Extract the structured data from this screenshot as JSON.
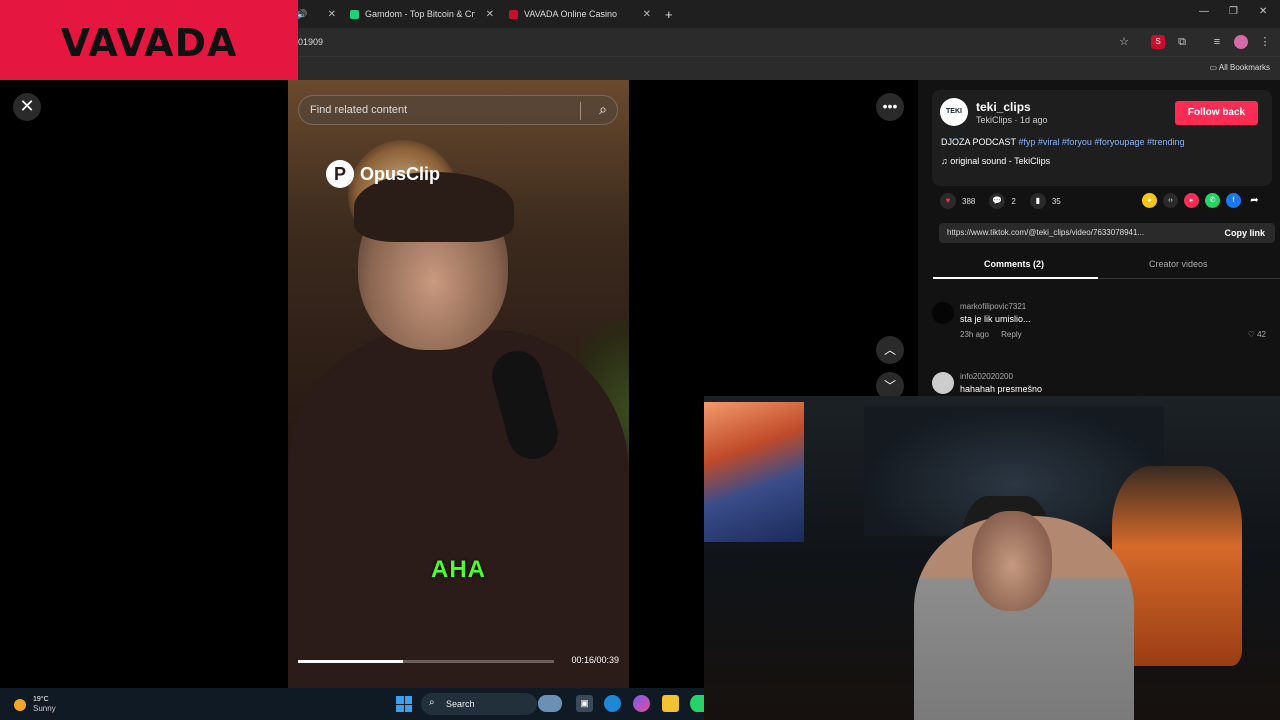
{
  "browser": {
    "tabs": [
      {
        "title": "Gamdom - Top Bitcoin & Crypto",
        "favicon_color": "#1fd17a"
      },
      {
        "title": "VAVADA Online Casino",
        "favicon_color": "#c8102e"
      }
    ],
    "url_fragment": "01909",
    "bookmarks_label": "All Bookmarks"
  },
  "overlay_logo": {
    "text": "VAVADA",
    "bg_color": "#e5163f"
  },
  "video": {
    "search_placeholder": "Find related content",
    "watermark": "OpusClip",
    "caption": "AHA",
    "time": "00:16/00:39",
    "progress_fraction": 0.41
  },
  "creator": {
    "handle": "teki_clips",
    "display_name": "TekiClips",
    "posted": "1d ago",
    "sub_line": "TekiClips · 1d ago",
    "avatar_text": "TEKI CLIPS",
    "follow_label": "Follow back",
    "description_text": "DJOZA PODCAST",
    "hashtags": "#fyp #viral #foryou #foryoupage #trending",
    "sound": "original sound - TekiClips"
  },
  "stats": {
    "likes": "388",
    "comments": "2",
    "saves": "35"
  },
  "share": {
    "link": "https://www.tiktok.com/@teki_clips/video/7633078941...",
    "copy_label": "Copy link"
  },
  "panel_tabs": [
    {
      "label": "Comments (2)"
    },
    {
      "label": "Creator videos"
    }
  ],
  "comments": [
    {
      "user": "markofilipovic7321",
      "text": "sta je lik umislio...",
      "time": "23h ago",
      "reply": "Reply",
      "likes": "42"
    },
    {
      "user": "info202020200",
      "text": "hahahah presmešno"
    }
  ],
  "taskbar": {
    "temp": "19°C",
    "condition": "Sunny",
    "search_label": "Search"
  },
  "accent_colors": {
    "follow": "#fe2c55",
    "hashtag": "#8ab4ff",
    "caption": "#4dff2e"
  }
}
